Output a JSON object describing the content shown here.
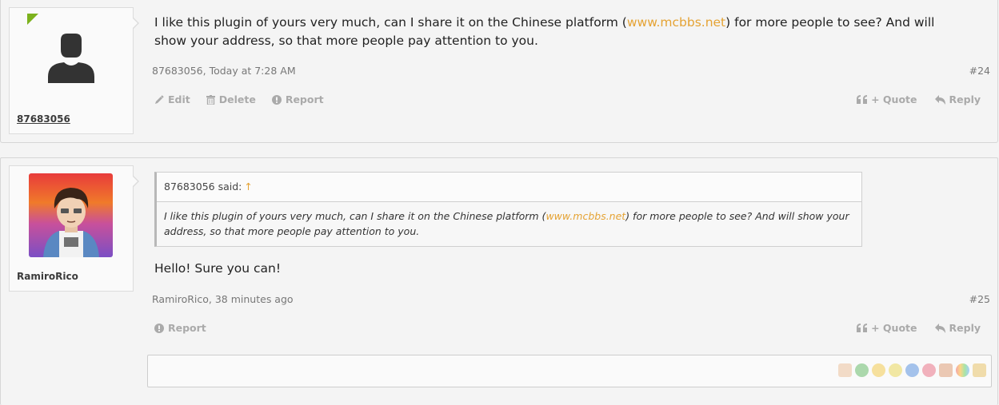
{
  "posts": [
    {
      "username": "87683056",
      "message_pre": "I like this plugin of yours very much, can I share it on the Chinese platform (",
      "message_link": "www.mcbbs.net",
      "message_post": ") for more people to see? And will show your address, so that more people pay attention to you.",
      "meta": "87683056, Today at 7:28 AM",
      "post_number": "#24",
      "actions_left": {
        "edit": "Edit",
        "delete": "Delete",
        "report": "Report"
      },
      "actions_right": {
        "quote": "+ Quote",
        "reply": "Reply"
      }
    },
    {
      "username": "RamiroRico",
      "quote_author": "87683056 said:",
      "quote_arrow": "↑",
      "quote_pre": "I like this plugin of yours very much, can I share it on the Chinese platform (",
      "quote_link": "www.mcbbs.net",
      "quote_post": ") for more people to see? And will show your address, so that more people pay attention to you.",
      "message": "Hello! Sure you can!",
      "meta": "RamiroRico, 38 minutes ago",
      "post_number": "#25",
      "actions_left": {
        "report": "Report"
      },
      "actions_right": {
        "quote": "+ Quote",
        "reply": "Reply"
      }
    }
  ],
  "editor": {
    "emoji_icons": [
      "thumbs-up",
      "check",
      "smile",
      "star",
      "info",
      "heart",
      "wrench",
      "rainbow",
      "pencil"
    ]
  },
  "colors": {
    "link": "#e5a334",
    "online": "#7cb21d",
    "muted": "#aaaaaa"
  }
}
